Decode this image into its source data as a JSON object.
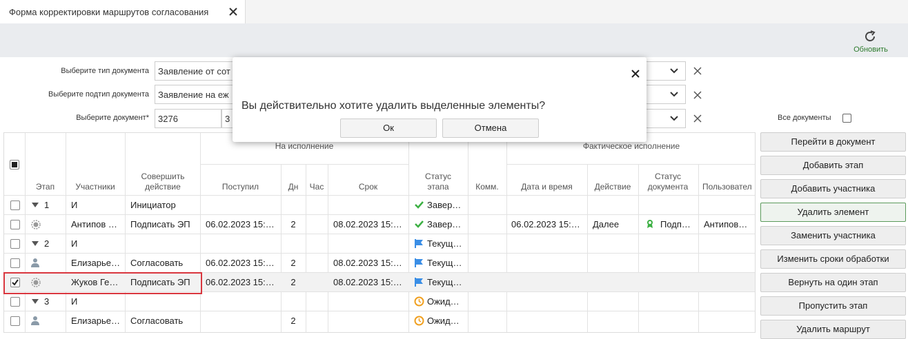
{
  "tab": {
    "title": "Форма корректировки маршрутов согласования"
  },
  "toolbar": {
    "refresh_label": "Обновить"
  },
  "filters": {
    "doc_type_label": "Выберите тип документа",
    "doc_type_value": "Заявление от сот",
    "doc_subtype_label": "Выберите подтип документа",
    "doc_subtype_value": "Заявление на еж",
    "document_label": "Выберите документ*",
    "document_value": "3276",
    "document_value2": "3",
    "all_docs_label": "Все документы"
  },
  "grid": {
    "headers": {
      "stage": "Этап",
      "participants": "Участники",
      "action": "Совершить действие",
      "group_exec": "На исполнение",
      "received": "Поступил",
      "days": "Дн",
      "hours": "Час",
      "deadline": "Срок",
      "stage_status": "Статус этапа",
      "comm": "Комм.",
      "group_actual": "Фактическое исполнение",
      "datetime": "Дата и время",
      "act": "Действие",
      "doc_status": "Статус документа",
      "user": "Пользовател"
    },
    "rows": [
      {
        "stage": "1",
        "participant": "И",
        "action": "Инициатор",
        "received": "",
        "days": "",
        "deadline": "",
        "status": "Завер…",
        "status_icon": "check",
        "datetime": "",
        "act": "",
        "docstatus": "",
        "user": "",
        "icon": "",
        "expand": true
      },
      {
        "stage": "",
        "participant": "Антипов …",
        "action": "Подписать ЭП",
        "received": "06.02.2023 15:…",
        "days": "2",
        "deadline": "08.02.2023 15:…",
        "status": "Завер…",
        "status_icon": "check",
        "datetime": "06.02.2023 15:…",
        "act": "Далее",
        "docstatus": "Подп…",
        "user": "Антипов…",
        "icon": "gear",
        "expand": false
      },
      {
        "stage": "2",
        "participant": "И",
        "action": "",
        "received": "",
        "days": "",
        "deadline": "",
        "status": "Текущ…",
        "status_icon": "flag",
        "datetime": "",
        "act": "",
        "docstatus": "",
        "user": "",
        "icon": "",
        "expand": true
      },
      {
        "stage": "",
        "participant": "Елизарье…",
        "action": "Согласовать",
        "received": "06.02.2023 15:…",
        "days": "2",
        "deadline": "08.02.2023 15:…",
        "status": "Текущ…",
        "status_icon": "flag",
        "datetime": "",
        "act": "",
        "docstatus": "",
        "user": "",
        "icon": "user",
        "expand": false
      },
      {
        "stage": "",
        "participant": "Жуков Ге…",
        "action": "Подписать ЭП",
        "received": "06.02.2023 15:…",
        "days": "2",
        "deadline": "08.02.2023 15:…",
        "status": "Текущ…",
        "status_icon": "flag",
        "datetime": "",
        "act": "",
        "docstatus": "",
        "user": "",
        "icon": "gear",
        "expand": false
      },
      {
        "stage": "3",
        "participant": "И",
        "action": "",
        "received": "",
        "days": "",
        "deadline": "",
        "status": "Ожид…",
        "status_icon": "clock",
        "datetime": "",
        "act": "",
        "docstatus": "",
        "user": "",
        "icon": "",
        "expand": true
      },
      {
        "stage": "",
        "participant": "Елизарье…",
        "action": "Согласовать",
        "received": "",
        "days": "2",
        "deadline": "",
        "status": "Ожид…",
        "status_icon": "clock",
        "datetime": "",
        "act": "",
        "docstatus": "",
        "user": "",
        "icon": "user",
        "expand": false
      }
    ]
  },
  "buttons": [
    "Перейти в документ",
    "Добавить этап",
    "Добавить участника",
    "Удалить элемент",
    "Заменить участника",
    "Изменить сроки обработки",
    "Вернуть на один этап",
    "Пропустить этап",
    "Удалить маршрут"
  ],
  "dialog": {
    "message": "Вы действительно хотите удалить выделенные элементы?",
    "ok_label": "Ок",
    "cancel_label": "Отмена"
  },
  "colors": {
    "accent_green": "#2c7a2c",
    "selection_red": "#d9363e",
    "check_green": "#3cb043",
    "flag_blue": "#3a8ee6",
    "clock_orange": "#f0a020"
  }
}
